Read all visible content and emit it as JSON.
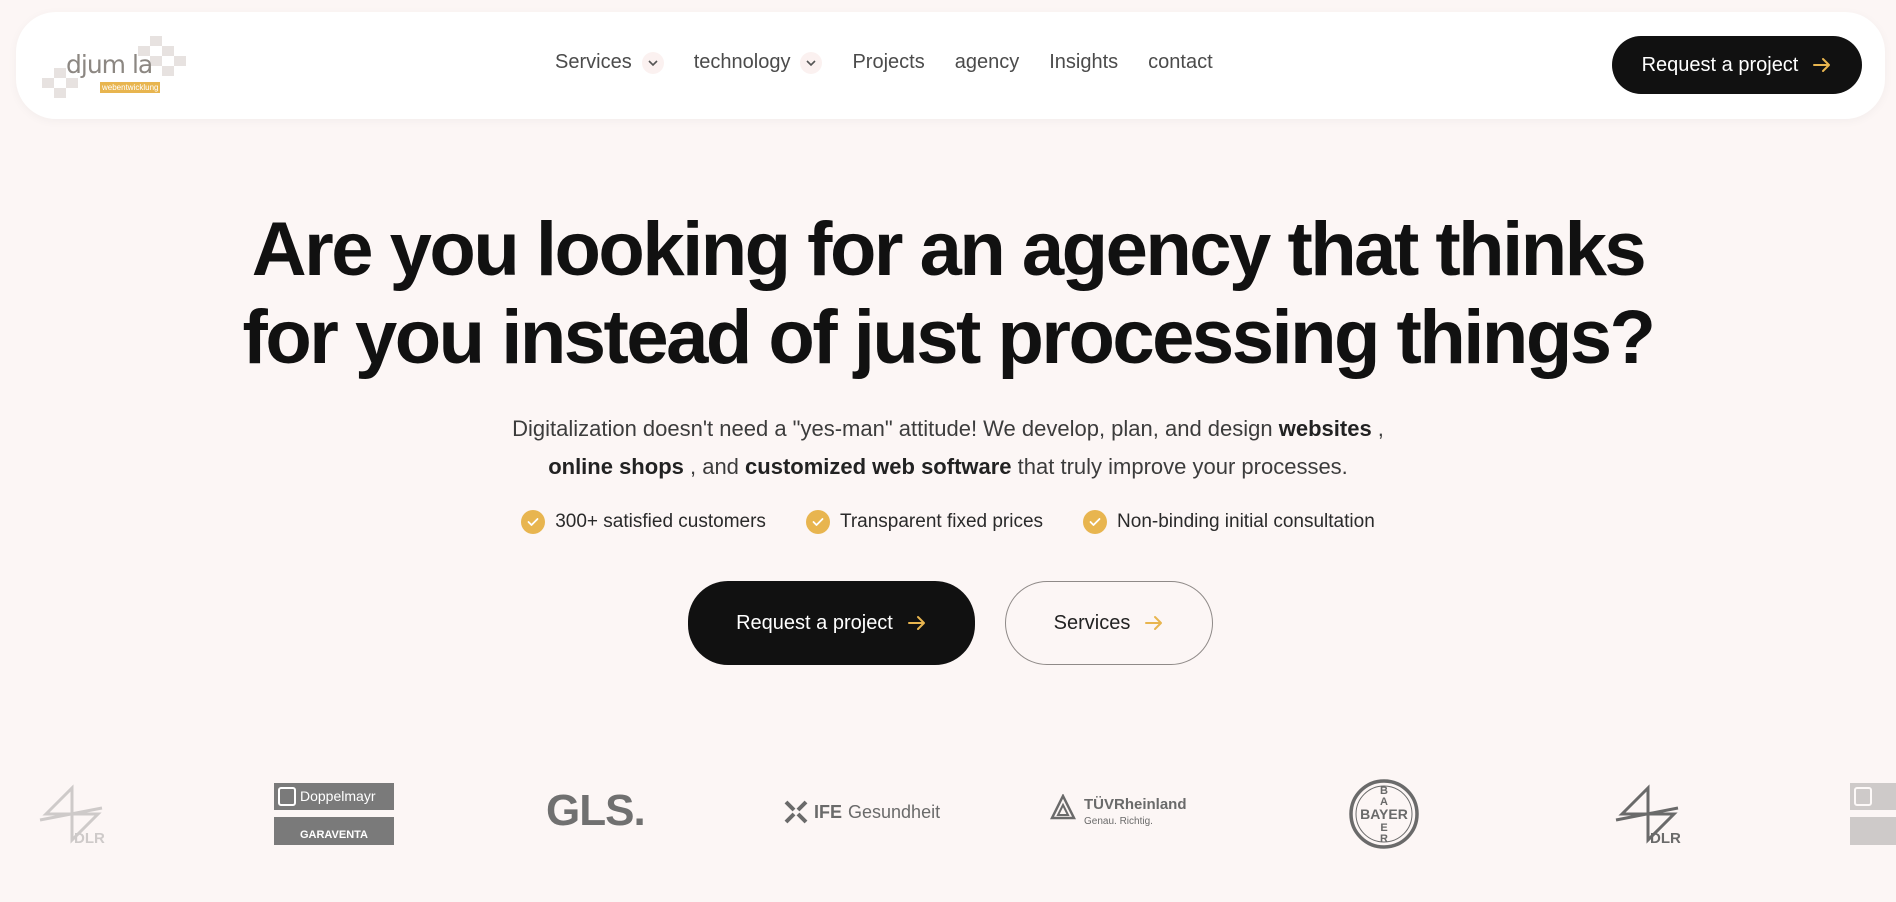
{
  "header": {
    "logo": {
      "word": "djum la",
      "tagline": "webentwicklung"
    },
    "nav": [
      {
        "label": "Services",
        "dropdown": true
      },
      {
        "label": "technology",
        "dropdown": true
      },
      {
        "label": "Projects",
        "dropdown": false
      },
      {
        "label": "agency",
        "dropdown": false
      },
      {
        "label": "Insights",
        "dropdown": false
      },
      {
        "label": "contact",
        "dropdown": false
      }
    ],
    "cta_label": "Request a project"
  },
  "hero": {
    "title_line1": "Are you looking for an agency that thinks",
    "title_line2": "for you instead of just processing things?",
    "sub": {
      "t1": "Digitalization doesn't need a \"yes-man\" attitude! We develop, plan, and design ",
      "b1": "websites",
      "t2": " ,",
      "b2": "online shops",
      "t3": " , and ",
      "b3": "customized web software",
      "t4": " that truly improve your processes."
    },
    "features": [
      "300+ satisfied customers",
      "Transparent fixed prices",
      "Non-binding initial consultation"
    ],
    "primary_cta": "Request a project",
    "secondary_cta": "Services"
  },
  "clients": {
    "dlr": "DLR",
    "doppelmayr": "Doppelmayr",
    "garaventa": "GARAVENTA",
    "gls": "GLS.",
    "ife": "IFE",
    "ife_sub": "Gesundheit",
    "tuv": "TÜVRheinland",
    "tuv_sub": "Genau. Richtig.",
    "bayer": "BAYER"
  },
  "colors": {
    "background": "#fcf6f5",
    "accent": "#e8b54f",
    "dark": "#111111",
    "logo_gray": "#7a7a7a"
  },
  "icons": [
    "chevron-down-icon",
    "arrow-right-icon",
    "check-icon"
  ]
}
